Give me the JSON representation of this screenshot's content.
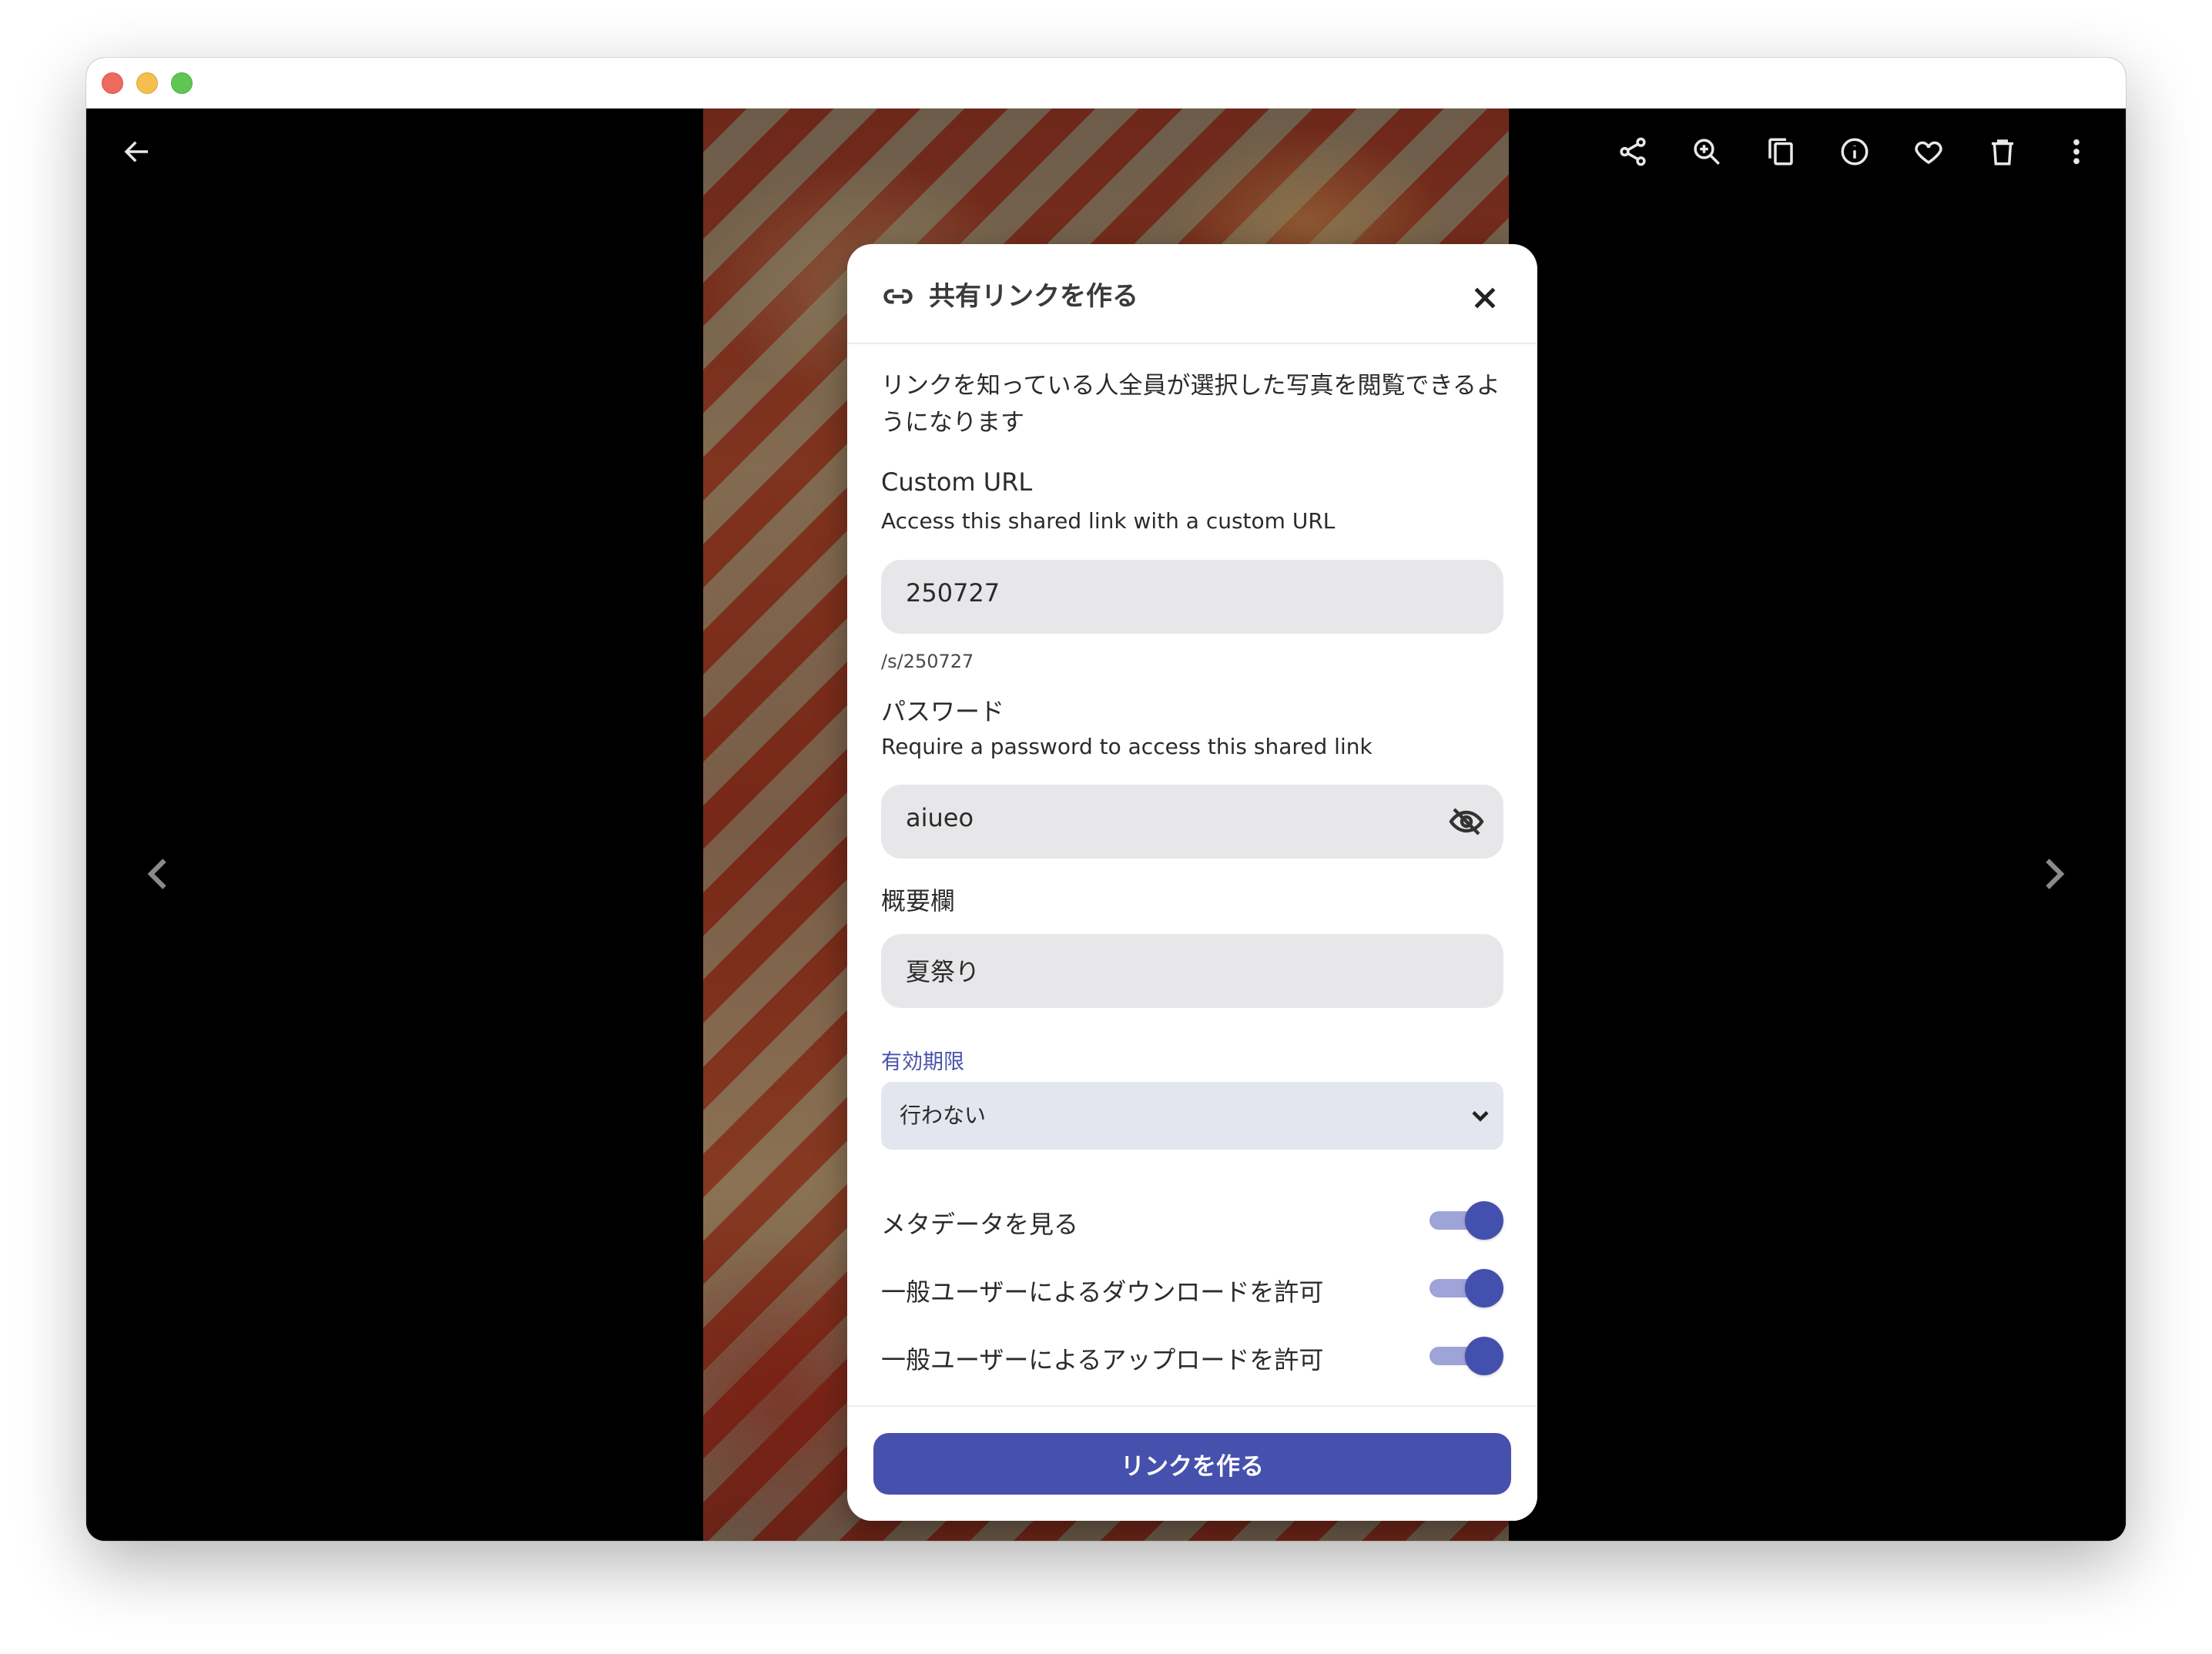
{
  "viewer": {
    "back_icon": "arrow-left-icon",
    "toolbar_icons": [
      "share-icon",
      "zoom-in-icon",
      "copy-icon",
      "info-icon",
      "heart-icon",
      "trash-icon",
      "more-vertical-icon"
    ],
    "prev_icon": "chevron-left-icon",
    "next_icon": "chevron-right-icon"
  },
  "dialog": {
    "title": "共有リンクを作る",
    "description": "リンクを知っている人全員が選択した写真を閲覧できるようになります",
    "custom_url": {
      "label": "Custom URL",
      "sublabel": "Access this shared link with a custom URL",
      "value": "250727",
      "hint": "/s/250727"
    },
    "password": {
      "label": "パスワード",
      "sublabel": "Require a password to access this shared link",
      "value": "aiueo"
    },
    "summary": {
      "label": "概要欄",
      "value": "夏祭り"
    },
    "expiry": {
      "label": "有効期限",
      "selected": "行わない"
    },
    "toggles": [
      {
        "label": "メタデータを見る",
        "on": true
      },
      {
        "label": "一般ユーザーによるダウンロードを許可",
        "on": true
      },
      {
        "label": "一般ユーザーによるアップロードを許可",
        "on": true
      }
    ],
    "submit_label": "リンクを作る"
  },
  "colors": {
    "accent": "#4651ad",
    "toggle_track": "#9ea3d8",
    "field_bg": "#e7e7ea"
  }
}
